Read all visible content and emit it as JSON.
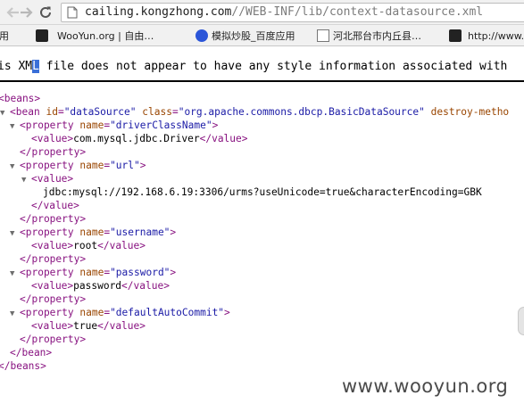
{
  "address_bar": {
    "host": "cailing.kongzhong.com",
    "path": "//WEB-INF/lib/context-datasource.xml"
  },
  "bookmarks": [
    {
      "label": "应用",
      "icon": "apps-icon"
    },
    {
      "label": "WooYun.org | 自由…",
      "icon": "wooyun-icon"
    },
    {
      "label": "模拟炒股_百度应用",
      "icon": "baidu-paw-icon"
    },
    {
      "label": "河北邢台市内丘县…",
      "icon": "page-icon"
    },
    {
      "label": "http://www.",
      "icon": "wooyun-icon"
    }
  ],
  "info_message": {
    "before": "is ",
    "highlight_start": "XM",
    "highlight_char": "L",
    "after": " file does not appear to have any style information associated with"
  },
  "xml": {
    "open_beans": "<beans>",
    "close_beans": "</beans>",
    "bean": {
      "tag": "bean",
      "attrs": [
        {
          "name": "id",
          "value": "\"dataSource\""
        },
        {
          "name": "class",
          "value": "\"org.apache.commons.dbcp.BasicDataSource\""
        },
        {
          "name": "destroy-metho",
          "value": ""
        }
      ],
      "close": "</bean>"
    },
    "properties": [
      {
        "name_attr": "\"driverClassName\"",
        "value": "com.mysql.jdbc.Driver"
      },
      {
        "name_attr": "\"url\"",
        "value": "jdbc:mysql://192.168.6.19:3306/urms?useUnicode=true&characterEncoding=GBK"
      },
      {
        "name_attr": "\"username\"",
        "value": "root"
      },
      {
        "name_attr": "\"password\"",
        "value": "password"
      },
      {
        "name_attr": "\"defaultAutoCommit\"",
        "value": "true"
      }
    ]
  },
  "watermark": "www.wooyun.org"
}
